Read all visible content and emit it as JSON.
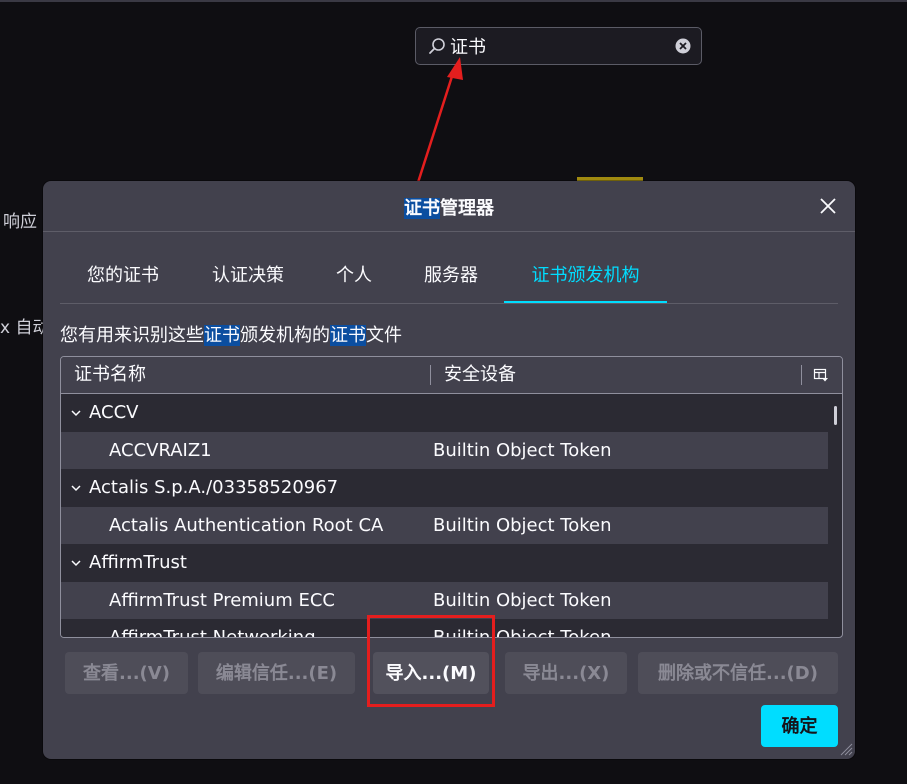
{
  "background": {
    "text_1": "响应",
    "text_2": "x 自动"
  },
  "search": {
    "value": "证书",
    "placeholder": ""
  },
  "dialog": {
    "title_highlight": "证书",
    "title_rest": "管理器",
    "tabs": [
      {
        "label": "您的证书",
        "active": false
      },
      {
        "label": "认证决策",
        "active": false
      },
      {
        "label": "个人",
        "active": false
      },
      {
        "label": "服务器",
        "active": false
      },
      {
        "label": "证书颁发机构",
        "active": true
      }
    ],
    "description": {
      "part1": "您有用来识别这些",
      "hl1": "证书",
      "part2": "颁发机构的",
      "hl2": "证书",
      "part3": "文件"
    },
    "table": {
      "col_name": "证书名称",
      "col_device": "安全设备",
      "rows": [
        {
          "type": "group",
          "name": "ACCV",
          "device": ""
        },
        {
          "type": "child",
          "name": "ACCVRAIZ1",
          "device": "Builtin Object Token"
        },
        {
          "type": "group",
          "name": "Actalis S.p.A./03358520967",
          "device": ""
        },
        {
          "type": "child",
          "name": "Actalis Authentication Root CA",
          "device": "Builtin Object Token"
        },
        {
          "type": "group",
          "name": "AffirmTrust",
          "device": ""
        },
        {
          "type": "child",
          "name": "AffirmTrust Premium ECC",
          "device": "Builtin Object Token"
        },
        {
          "type": "child",
          "name": "AffirmTrust Networking",
          "device": "Builtin Object Token"
        }
      ]
    },
    "buttons": {
      "view": "查看...(V)",
      "edit_trust": "编辑信任...(E)",
      "import": "导入...(M)",
      "export": "导出...(X)",
      "delete": "删除或不信任...(D)",
      "ok": "确定"
    }
  },
  "colors": {
    "accent": "#00ddff",
    "highlight": "#0b4ea0",
    "annotation_red": "#e41e1e"
  }
}
